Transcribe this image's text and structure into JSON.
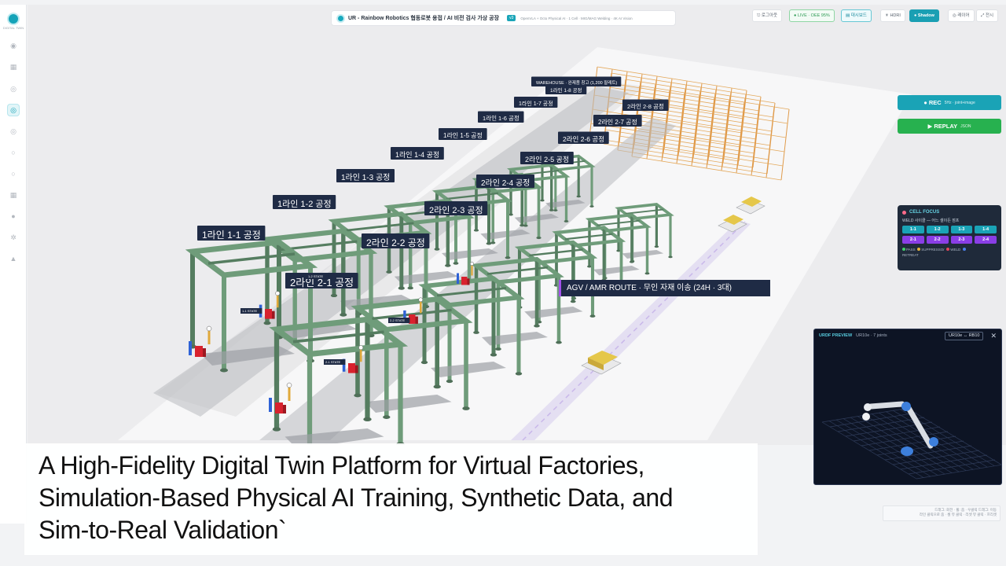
{
  "sidebar": {
    "logo_text": "DIGITAL TWIN",
    "icons": [
      "grid-icon",
      "grid-icon",
      "robot-icon",
      "factory-icon",
      "chart-icon",
      "cube-icon",
      "circle-icon",
      "grid-icon",
      "dot-icon",
      "gear-icon",
      "warning-icon"
    ]
  },
  "titlebar": {
    "title": "UR - Rainbow Robotics 협동로봇 용접 / AI 비전 검사 가상 공장",
    "version": "v3",
    "subtitle": "OpenVLA + Octo Physical AI · 1 Cell · MIG/MAG Welding · 4K AI Vision"
  },
  "top_buttons": {
    "logout": "⎋ 로그아웃",
    "live": "● LIVE · OEE 95%",
    "dashboard": "▤ 대시보드",
    "hdri": "☀ HDRI",
    "shadow": "● Shadow",
    "layer": "◎ 레이어",
    "fullscreen": "⤢ 전시"
  },
  "recorder": {
    "rec_label": "● REC",
    "rec_note": "5Hz · joint+image",
    "replay_label": "▶ REPLAY",
    "replay_note": "JSON"
  },
  "cell_focus": {
    "title": "CELL FOCUS",
    "subtitle": "WELD 사이클 — 어느 셀이든 점프",
    "line1": [
      "1-1",
      "1-2",
      "1-3",
      "1-4"
    ],
    "line2": [
      "2-1",
      "2-2",
      "2-3",
      "2-4"
    ],
    "legend": [
      "PASS",
      "SUPPRESSOr",
      "WELD",
      "RETREAT"
    ],
    "legend_colors": [
      "#3fcf6a",
      "#e7b53a",
      "#e3455a",
      "#4a7ee8"
    ]
  },
  "scene": {
    "warehouse_label": "WAREHOUSE · 완제품 창고 (1,200 팔레트)",
    "agv_route_label": "AGV / AMR ROUTE · 무인 자재 이송 (24H · 3대)",
    "line1_cells": [
      "1라인 1-1 공정",
      "1라인 1-2 공정",
      "1라인 1-3 공정",
      "1라인 1-4 공정",
      "1라인 1-5 공정",
      "1라인 1-6 공정",
      "1라인 1-7 공정",
      "1라인 1-8 공정"
    ],
    "line2_cells": [
      "2라인 2-1 공정",
      "2라인 2-2 공정",
      "2라인 2-3 공정",
      "2라인 2-4 공정",
      "2라인 2-5 공정",
      "2라인 2-6 공정",
      "2라인 2-7 공정",
      "2라인 2-8 공정"
    ],
    "state_tags": [
      "1-1 STATE",
      "2-1 STATE",
      "2-2 STATE",
      "1-2 STATE"
    ]
  },
  "urdf_preview": {
    "title": "URDF PREVIEW",
    "subtitle": "UR10e · 7 joints",
    "toggle": "UR10e ↔ RB10",
    "close": "✕"
  },
  "hint": {
    "line1": "드래그: 회전 · 휠: 줌 · 우클릭 드래그: 이동",
    "line2": "라인 클릭으로 줌 · 셀 뷰 클릭 · 리셋 뷰 클릭 · 프리셋"
  },
  "caption": {
    "line1": "A High-Fidelity Digital Twin Platform for Virtual Factories,",
    "line2": "Simulation-Based Physical AI Training, Synthetic Data, and",
    "line3": "Sim-to-Real Validation`"
  },
  "colors": {
    "accent": "#1aa3b6",
    "frame": "#6f9c7a",
    "label_bg": "#1f2b45",
    "replay": "#27b14f",
    "line2_badge": "#8a3ee6"
  }
}
